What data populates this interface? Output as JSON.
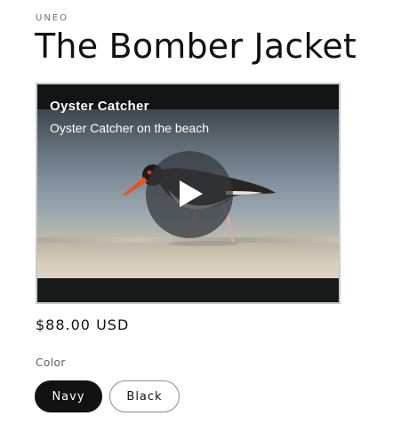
{
  "product": {
    "vendor": "UNEO",
    "title": "The Bomber Jacket",
    "price": "$88.00 USD"
  },
  "video": {
    "title": "Oyster Catcher",
    "subtitle": "Oyster Catcher on the beach",
    "play_icon": "play-icon"
  },
  "options": {
    "color_label": "Color",
    "values": [
      "Navy",
      "Black"
    ],
    "selected": "Navy"
  },
  "colors": {
    "text": "#121212",
    "selected_swatch_bg": "#121212",
    "swatch_border": "#8a8a8a"
  }
}
